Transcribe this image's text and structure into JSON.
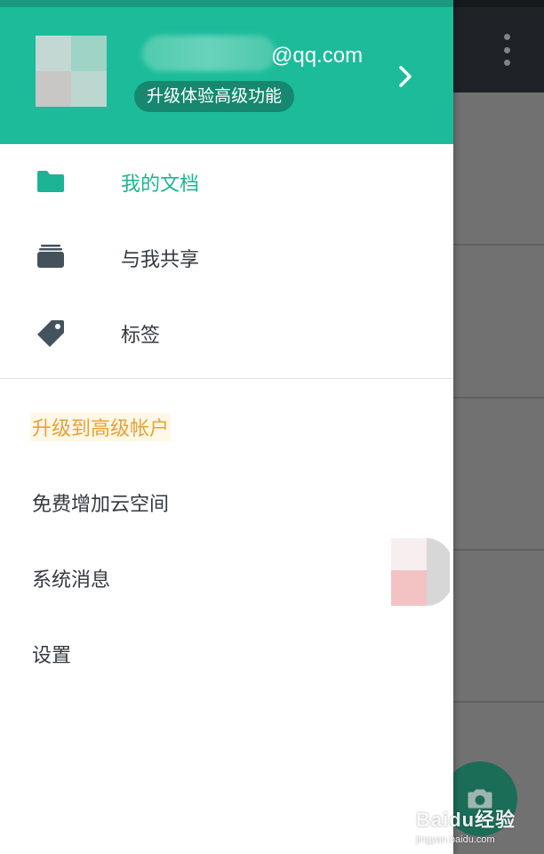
{
  "header": {
    "email_suffix": "@qq.com",
    "upgrade_chip_label": "升级体验高级功能",
    "color": "#1cbc9b"
  },
  "nav": {
    "items": [
      {
        "label": "我的文档",
        "icon": "folder-icon",
        "active": true
      },
      {
        "label": "与我共享",
        "icon": "shared-stack-icon",
        "active": false
      },
      {
        "label": "标签",
        "icon": "tag-icon",
        "active": false
      }
    ]
  },
  "extra": {
    "items": [
      {
        "label": "升级到高级帐户",
        "color": "#e6a23a"
      },
      {
        "label": "免费增加云空间"
      },
      {
        "label": "系统消息"
      },
      {
        "label": "设置"
      }
    ]
  },
  "background": {
    "more_icon": "more-vert-icon",
    "fab_icon": "camera-icon"
  },
  "watermark": {
    "logo": "Baidu经验",
    "url": "jingyan.baidu.com"
  }
}
